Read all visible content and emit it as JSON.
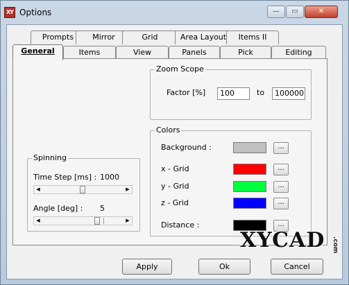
{
  "window": {
    "title": "Options",
    "icon": "app-logo-icon",
    "icon_text": "XY",
    "minimize": "—",
    "maximize": "▭",
    "close": "✕"
  },
  "tabs_back": [
    "Prompts",
    "Mirror",
    "Grid",
    "Area Layout",
    "Items II"
  ],
  "tabs_front": [
    "General",
    "Items",
    "View",
    "Panels",
    "Pick",
    "Editing"
  ],
  "active_tab": "General",
  "zoom_scope": {
    "title": "Zoom Scope",
    "factor_label": "Factor [%]",
    "from_value": "100",
    "to_label": "to",
    "to_value": "100000"
  },
  "colors": {
    "title": "Colors",
    "items": [
      {
        "label": "Background :",
        "color": "#c0c0c0",
        "button": "..."
      },
      {
        "label": "x - Grid",
        "color": "#ff0000",
        "button": "..."
      },
      {
        "label": "y - Grid",
        "color": "#00ff40",
        "button": "..."
      },
      {
        "label": "z - Grid",
        "color": "#0000ff",
        "button": "..."
      },
      {
        "label": "Distance :",
        "color": "#000000",
        "button": "..."
      }
    ]
  },
  "spinning": {
    "title": "Spinning",
    "time_step_label": "Time Step [ms] :",
    "time_step_value": "1000",
    "time_step_position": 0.5,
    "angle_label": "Angle [deg] :",
    "angle_value": "5",
    "angle_position": 0.7
  },
  "buttons": {
    "apply": "Apply",
    "ok": "Ok",
    "cancel": "Cancel"
  },
  "watermark": {
    "text": "XYCAD",
    "suffix": ".com"
  }
}
